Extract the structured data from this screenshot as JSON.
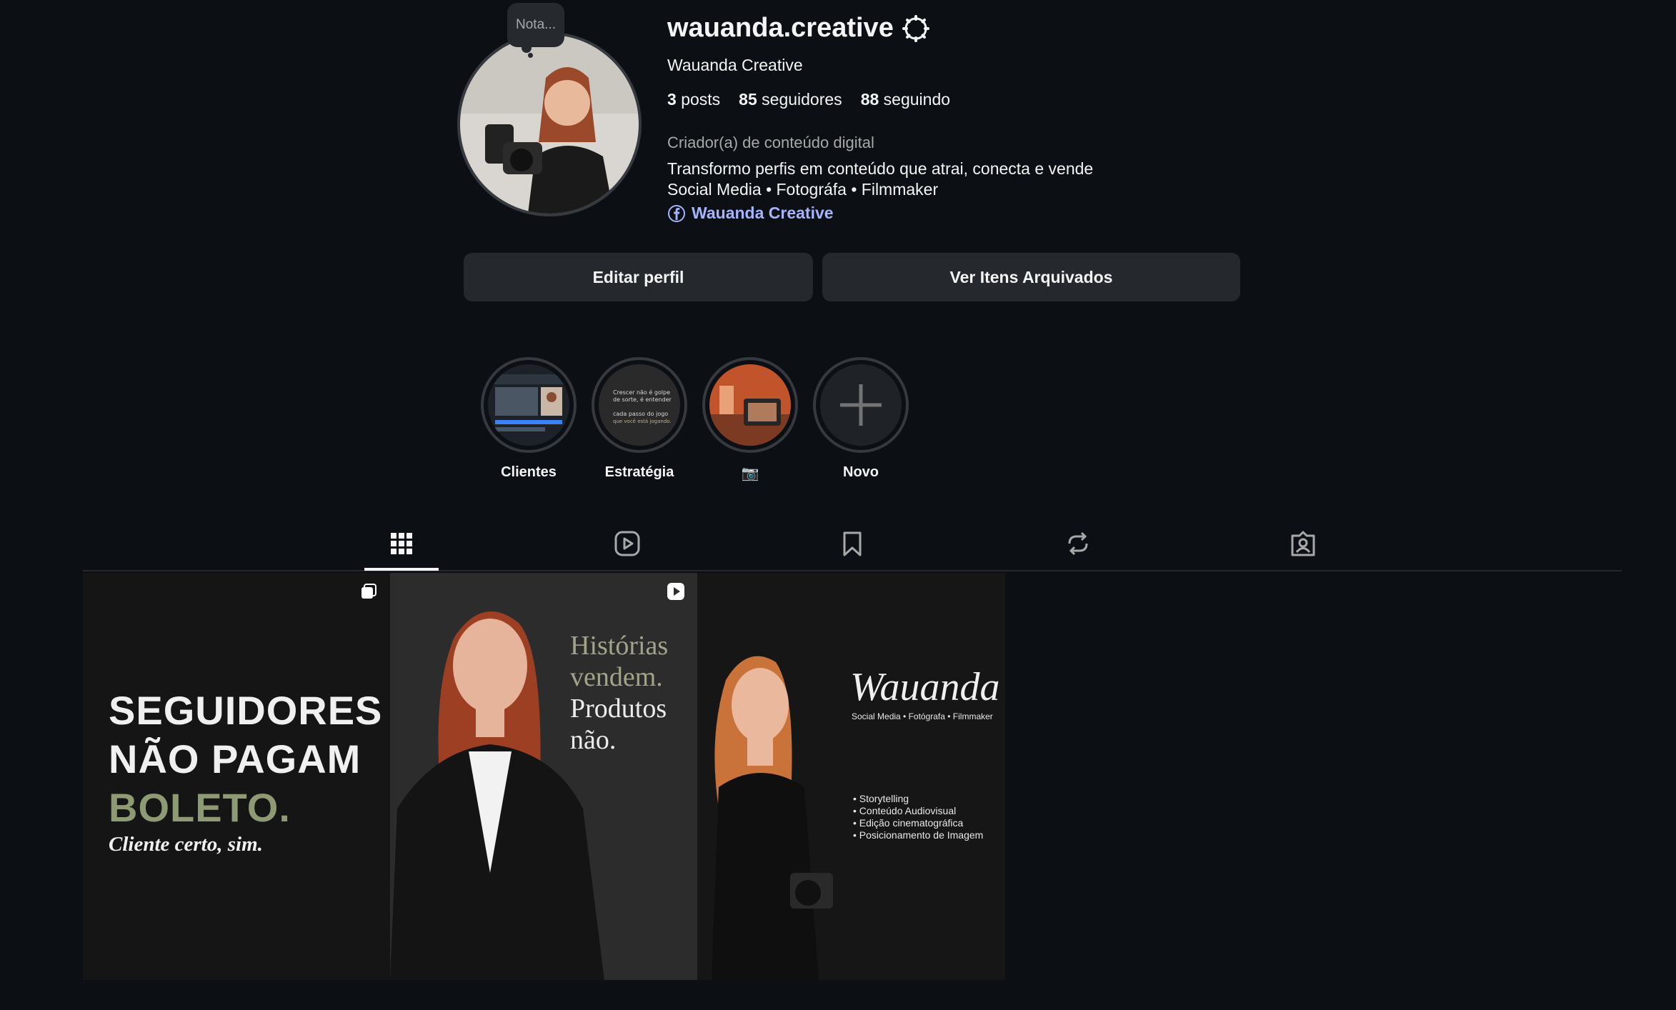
{
  "profile": {
    "note": "Nota...",
    "username": "wauanda.creative",
    "full_name": "Wauanda Creative",
    "stats": {
      "posts_count": "3",
      "posts_label": "posts",
      "followers_count": "85",
      "followers_label": "seguidores",
      "following_count": "88",
      "following_label": "seguindo"
    },
    "category": "Criador(a) de conteúdo digital",
    "bio_line1": "Transformo perfis em conteúdo que atrai, conecta e vende",
    "bio_line2": "Social Media • Fotográfa • Filmmaker",
    "link_label": "Wauanda Creative"
  },
  "buttons": {
    "edit_profile": "Editar perfil",
    "archived": "Ver Itens Arquivados"
  },
  "highlights": [
    {
      "label": "Clientes",
      "icon": "video-editor-thumbnail"
    },
    {
      "label": "Estratégia",
      "icon": "text-thumbnail",
      "thumb_text": [
        "Crescer não é golpe",
        "de sorte, é entender",
        "cada passo do jogo",
        "que você está jogando."
      ]
    },
    {
      "label": "📷",
      "icon": "camera-thumbnail"
    },
    {
      "label": "Novo",
      "icon": "plus-icon"
    }
  ],
  "tabs": [
    {
      "name": "posts",
      "icon": "grid-icon",
      "active": true
    },
    {
      "name": "reels",
      "icon": "reels-icon",
      "active": false
    },
    {
      "name": "saved",
      "icon": "bookmark-icon",
      "active": false
    },
    {
      "name": "reposts",
      "icon": "repost-icon",
      "active": false
    },
    {
      "name": "tagged",
      "icon": "tagged-icon",
      "active": false
    }
  ],
  "posts": [
    {
      "type_icon": "carousel-icon",
      "lines": [
        "SEGUIDORES",
        "NÃO PAGAM",
        "BOLETO.",
        "Cliente certo, sim."
      ]
    },
    {
      "type_icon": "reel-icon",
      "lines": [
        "Histórias",
        "vendem.",
        "Produtos",
        "não."
      ]
    },
    {
      "type_icon": "",
      "title": "Wauanda",
      "subtitle": "Social Media • Fotógrafa • Filmmaker",
      "list": [
        "• Storytelling",
        "• Conteúdo Audiovisual",
        "• Edição cinematográfica",
        "• Posicionamento de Imagem"
      ]
    }
  ],
  "colors": {
    "background": "#0c1014",
    "button_bg": "#25292e",
    "link": "#a5b4fc",
    "muted_text": "#a8a8a8",
    "accent_green": "#8d9a74"
  }
}
